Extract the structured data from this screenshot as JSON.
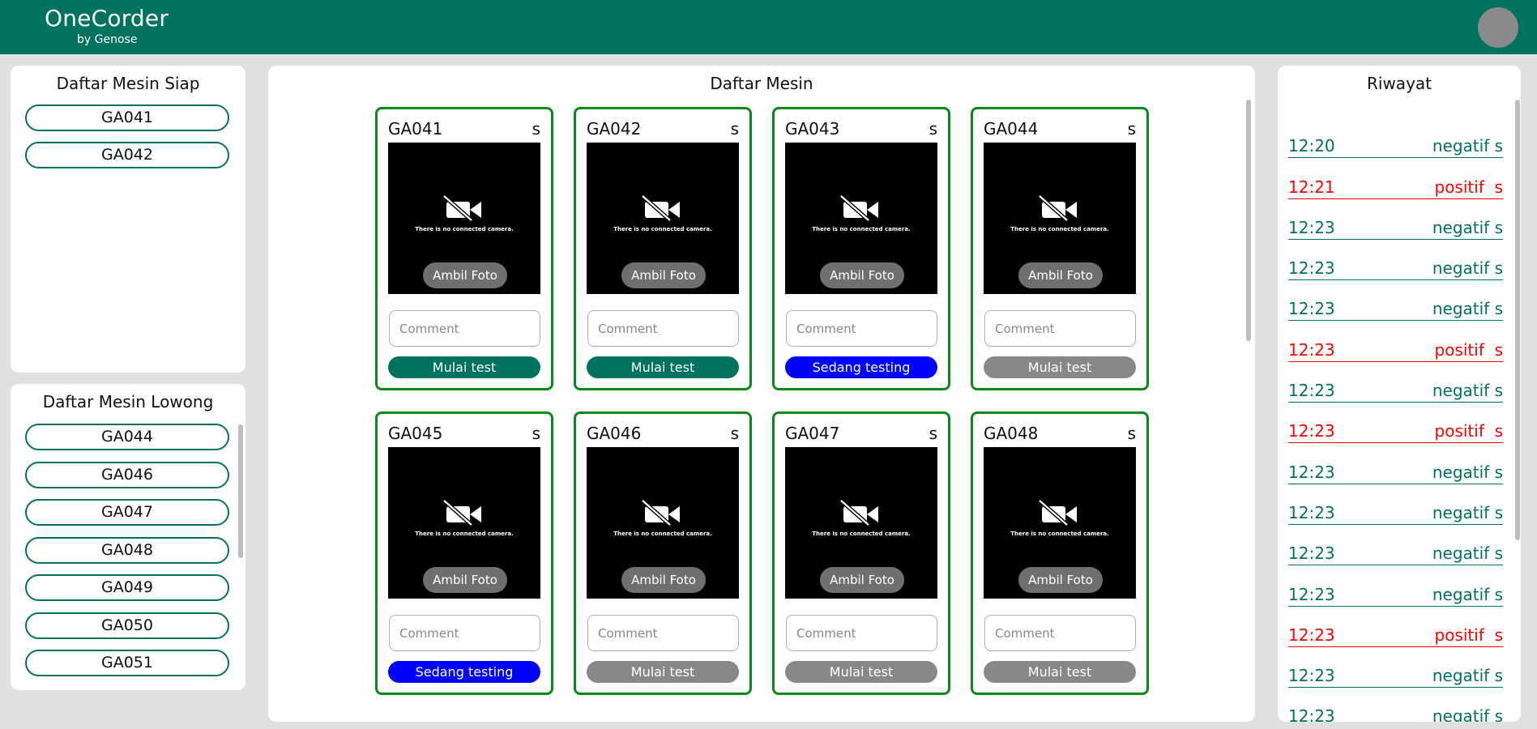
{
  "app": {
    "title": "OneCorder",
    "subtitle": "by Genose"
  },
  "colors": {
    "primary": "#00735f",
    "card_border": "#0a8a17",
    "testing": "#0000ff",
    "idle": "#888888",
    "positif": "#ff0000",
    "negatif": "#00735f"
  },
  "siap": {
    "title": "Daftar Mesin Siap",
    "items": [
      "GA041",
      "GA042"
    ]
  },
  "lowong": {
    "title": "Daftar Mesin Lowong",
    "items": [
      "GA044",
      "GA046",
      "GA047",
      "GA048",
      "GA049",
      "GA050",
      "GA051"
    ]
  },
  "mesin": {
    "title": "Daftar Mesin",
    "cards": [
      {
        "id": "GA041",
        "status_char": "s",
        "camera_msg": "There is no connected camera.",
        "foto_label": "Ambil Foto",
        "comment_placeholder": "Comment",
        "button_label": "Mulai test",
        "button_state": "ready"
      },
      {
        "id": "GA042",
        "status_char": "s",
        "camera_msg": "There is no connected camera.",
        "foto_label": "Ambil Foto",
        "comment_placeholder": "Comment",
        "button_label": "Mulai test",
        "button_state": "ready"
      },
      {
        "id": "GA043",
        "status_char": "s",
        "camera_msg": "There is no connected camera.",
        "foto_label": "Ambil Foto",
        "comment_placeholder": "Comment",
        "button_label": "Sedang testing",
        "button_state": "testing"
      },
      {
        "id": "GA044",
        "status_char": "s",
        "camera_msg": "There is no connected camera.",
        "foto_label": "Ambil Foto",
        "comment_placeholder": "Comment",
        "button_label": "Mulai test",
        "button_state": "idle"
      },
      {
        "id": "GA045",
        "status_char": "s",
        "camera_msg": "There is no connected camera.",
        "foto_label": "Ambil Foto",
        "comment_placeholder": "Comment",
        "button_label": "Sedang testing",
        "button_state": "testing"
      },
      {
        "id": "GA046",
        "status_char": "s",
        "camera_msg": "There is no connected camera.",
        "foto_label": "Ambil Foto",
        "comment_placeholder": "Comment",
        "button_label": "Mulai test",
        "button_state": "idle"
      },
      {
        "id": "GA047",
        "status_char": "s",
        "camera_msg": "There is no connected camera.",
        "foto_label": "Ambil Foto",
        "comment_placeholder": "Comment",
        "button_label": "Mulai test",
        "button_state": "idle"
      },
      {
        "id": "GA048",
        "status_char": "s",
        "camera_msg": "There is no connected camera.",
        "foto_label": "Ambil Foto",
        "comment_placeholder": "Comment",
        "button_label": "Mulai test",
        "button_state": "idle"
      }
    ]
  },
  "riwayat": {
    "title": "Riwayat",
    "entries": [
      {
        "time": "12:20",
        "result": "negatif s",
        "type": "negatif"
      },
      {
        "time": "12:21",
        "result": "positif  s",
        "type": "positif"
      },
      {
        "time": "12:23",
        "result": "negatif s",
        "type": "negatif"
      },
      {
        "time": "12:23",
        "result": "negatif s",
        "type": "negatif"
      },
      {
        "time": "12:23",
        "result": "negatif s",
        "type": "negatif"
      },
      {
        "time": "12:23",
        "result": "positif  s",
        "type": "positif"
      },
      {
        "time": "12:23",
        "result": "negatif s",
        "type": "negatif"
      },
      {
        "time": "12:23",
        "result": "positif  s",
        "type": "positif"
      },
      {
        "time": "12:23",
        "result": "negatif s",
        "type": "negatif"
      },
      {
        "time": "12:23",
        "result": "negatif s",
        "type": "negatif"
      },
      {
        "time": "12:23",
        "result": "negatif s",
        "type": "negatif"
      },
      {
        "time": "12:23",
        "result": "negatif s",
        "type": "negatif"
      },
      {
        "time": "12:23",
        "result": "positif  s",
        "type": "positif"
      },
      {
        "time": "12:23",
        "result": "negatif s",
        "type": "negatif"
      },
      {
        "time": "12:23",
        "result": "negatif s",
        "type": "negatif"
      }
    ]
  }
}
